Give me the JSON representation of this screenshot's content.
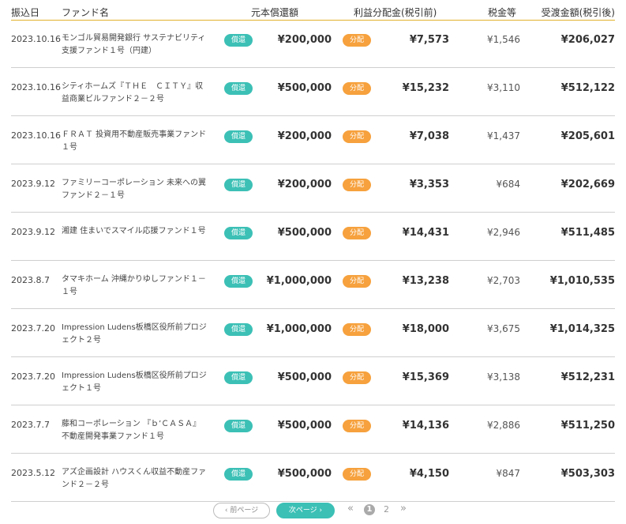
{
  "header": {
    "date": "振込日",
    "fund": "ファンド名",
    "principal": "元本償還額",
    "profit": "利益分配金(税引前)",
    "tax": "税金等",
    "received": "受渡金額(税引後)"
  },
  "badges": {
    "repay": "償還",
    "dist": "分配"
  },
  "rows": [
    {
      "date": "2023.10.16",
      "fund": "モンゴル貿易開発銀行 サステナビリティ支援ファンド１号（円建）",
      "principal": "¥200,000",
      "profit": "¥7,573",
      "tax": "¥1,546",
      "received": "¥206,027"
    },
    {
      "date": "2023.10.16",
      "fund": "シティホームズ『ＴＨＥ　ＣＩＴＹ』収益商業ビルファンド２－２号",
      "principal": "¥500,000",
      "profit": "¥15,232",
      "tax": "¥3,110",
      "received": "¥512,122"
    },
    {
      "date": "2023.10.16",
      "fund": "ＦＲＡＴ 投資用不動産販売事業ファンド１号",
      "principal": "¥200,000",
      "profit": "¥7,038",
      "tax": "¥1,437",
      "received": "¥205,601"
    },
    {
      "date": "2023.9.12",
      "fund": "ファミリーコーポレーション 未来への翼ファンド２－１号",
      "principal": "¥200,000",
      "profit": "¥3,353",
      "tax": "¥684",
      "received": "¥202,669"
    },
    {
      "date": "2023.9.12",
      "fund": "湘建 住まいでスマイル応援ファンド１号",
      "principal": "¥500,000",
      "profit": "¥14,431",
      "tax": "¥2,946",
      "received": "¥511,485"
    },
    {
      "date": "2023.8.7",
      "fund": "タマキホーム 沖縄かりゆしファンド１－１号",
      "principal": "¥1,000,000",
      "profit": "¥13,238",
      "tax": "¥2,703",
      "received": "¥1,010,535"
    },
    {
      "date": "2023.7.20",
      "fund": "Impression Ludens板橋区役所前プロジェクト２号",
      "principal": "¥1,000,000",
      "profit": "¥18,000",
      "tax": "¥3,675",
      "received": "¥1,014,325"
    },
    {
      "date": "2023.7.20",
      "fund": "Impression Ludens板橋区役所前プロジェクト１号",
      "principal": "¥500,000",
      "profit": "¥15,369",
      "tax": "¥3,138",
      "received": "¥512,231"
    },
    {
      "date": "2023.7.7",
      "fund": "藤和コーポレーション 『ｂ’ＣＡＳＡ』不動産開発事業ファンド１号",
      "principal": "¥500,000",
      "profit": "¥14,136",
      "tax": "¥2,886",
      "received": "¥511,250"
    },
    {
      "date": "2023.5.12",
      "fund": "アズ企画設計 ハウスくん収益不動産ファンド２－２号",
      "principal": "¥500,000",
      "profit": "¥4,150",
      "tax": "¥847",
      "received": "¥503,303"
    }
  ],
  "pager": {
    "prev": "‹ 前ページ",
    "next": "次ページ ›",
    "first": "«",
    "last": "»",
    "pages": [
      "1",
      "2"
    ],
    "current": "1"
  },
  "colors": {
    "teal": "#3cc0b6",
    "orange": "#f6a13d",
    "header_line": "#e1b22a"
  }
}
